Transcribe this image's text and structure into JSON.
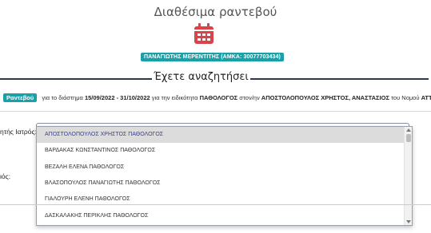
{
  "page": {
    "title": "Διαθέσιμα ραντεβού",
    "patient_badge": "ΠΑΝΑΓΙΩΤΗΣ ΜΕΡΕΝΤΙΤΗΣ (ΑΜΚΑ: 30077703434)"
  },
  "section": {
    "title": "Έχετε αναζητήσει"
  },
  "search_summary": {
    "chip": "Ραντεβού",
    "t1": "για το διάστημα",
    "period": "15/09/2022 - 31/10/2022",
    "t2": "για την ειδικότητα",
    "specialty": "ΠΑΘΟΛΟΓΟΣ",
    "t3": "στον/ην",
    "doctor": "ΑΠΟΣΤΟΛΟΠΟΥΛΟΣ ΧΡΗΣΤΟΣ, ΑΝΑΣΤΑΣΙΟΣ",
    "t4": "του Νομού",
    "prefecture": "ΑΤΤΙΚΗΣ"
  },
  "form": {
    "doctor_label": "ητής Ιατρός:",
    "second_label": "ιός:"
  },
  "dropdown": {
    "options": [
      "ΑΠΟΣΤΟΛΟΠΟΥΛΟΣ ΧΡΗΣΤΟΣ ΠΑΘΟΛΟΓΟΣ",
      "ΒΑΡΔΑΚΑΣ ΚΩΝΣΤΑΝΤΙΝΟΣ ΠΑΘΟΛΟΓΟΣ",
      "ΒΕΖΑΛΗ ΕΛΕΝΑ ΠΑΘΟΛΟΓΟΣ",
      "ΒΛΑΣΟΠΟΥΛΟΣ ΠΑΝΑΓΙΩΤΗΣ ΠΑΘΟΛΟΓΟΣ",
      "ΓΙΑΛΟΥΡΗ ΕΛΕΝΗ ΠΑΘΟΛΟΓΟΣ",
      "ΔΑΣΚΑΛΑΚΗΣ ΠΕΡΙΚΛΗΣ ΠΑΘΟΛΟΓΟΣ"
    ],
    "selected_index": 0
  },
  "colors": {
    "accent": "#1aa0a8",
    "icon_red": "#d9434a",
    "dark_rule": "#2b3a4a"
  },
  "icons": {
    "calendar": "calendar-icon"
  }
}
